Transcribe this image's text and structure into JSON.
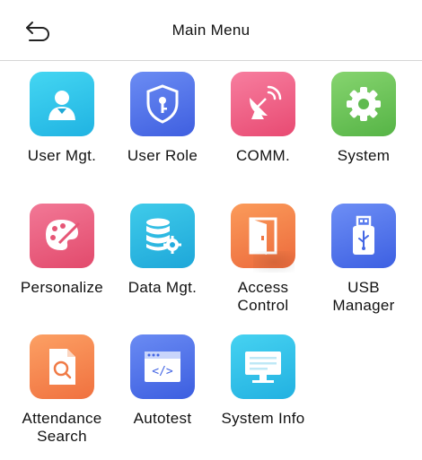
{
  "header": {
    "title": "Main Menu",
    "back_icon": "back-arrow-icon"
  },
  "menu": {
    "user_mgt": {
      "label": "User Mgt.",
      "icon": "user-icon",
      "color": "#2bc3e8"
    },
    "user_role": {
      "label": "User Role",
      "icon": "shield-key-icon",
      "color": "#4f70e8"
    },
    "comm": {
      "label": "COMM.",
      "icon": "satellite-dish-icon",
      "color": "#ef5f86"
    },
    "system": {
      "label": "System",
      "icon": "gear-icon",
      "color": "#6ec35d"
    },
    "personalize": {
      "label": "Personalize",
      "icon": "palette-icon",
      "color": "#ec5a7a"
    },
    "data_mgt": {
      "label": "Data Mgt.",
      "icon": "database-gear-icon",
      "color": "#2ab8e0"
    },
    "access_control": {
      "label": "Access\nControl",
      "icon": "door-icon",
      "color": "#f27b4a"
    },
    "usb_manager": {
      "label": "USB\nManager",
      "icon": "usb-drive-icon",
      "color": "#4d72ea"
    },
    "attendance_search": {
      "label": "Attendance\nSearch",
      "icon": "document-search-icon",
      "color": "#f5844f"
    },
    "autotest": {
      "label": "Autotest",
      "icon": "code-window-icon",
      "color": "#4a6fe8"
    },
    "system_info": {
      "label": "System Info",
      "icon": "monitor-icon",
      "color": "#2bbde6"
    }
  }
}
